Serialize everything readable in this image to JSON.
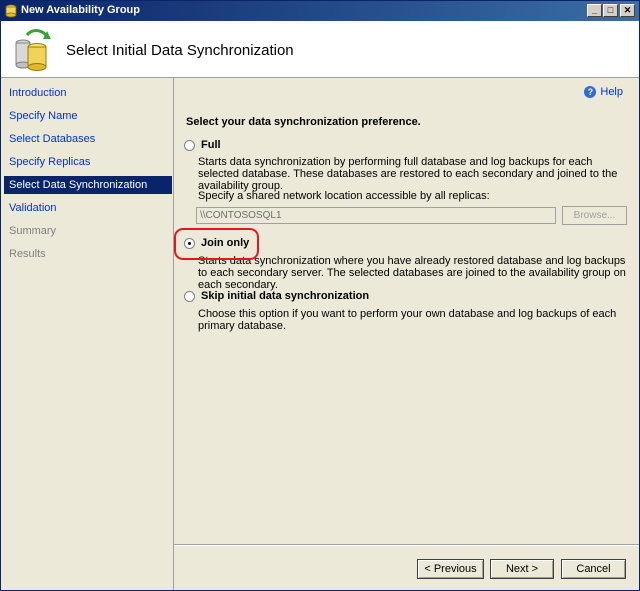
{
  "window": {
    "title": "New Availability Group",
    "controls": {
      "minimize": "_",
      "maximize": "□",
      "close": "✕"
    }
  },
  "header": {
    "title": "Select Initial Data Synchronization"
  },
  "sidebar": {
    "items": [
      {
        "label": "Introduction",
        "state": "link"
      },
      {
        "label": "Specify Name",
        "state": "link"
      },
      {
        "label": "Select Databases",
        "state": "link"
      },
      {
        "label": "Specify Replicas",
        "state": "link"
      },
      {
        "label": "Select Data Synchronization",
        "state": "selected"
      },
      {
        "label": "Validation",
        "state": "link"
      },
      {
        "label": "Summary",
        "state": "disabled"
      },
      {
        "label": "Results",
        "state": "disabled"
      }
    ]
  },
  "main": {
    "help_label": "Help",
    "prompt": "Select your data synchronization preference.",
    "options": [
      {
        "label": "Full",
        "selected": false,
        "description": "Starts data synchronization by performing full database and log backups for each selected database. These databases are restored to each secondary and joined to the availability group."
      },
      {
        "label": "Join only",
        "selected": true,
        "description": "Starts data synchronization where you have already restored database and log backups to each secondary server. The selected databases are joined to the availability group on each secondary."
      },
      {
        "label": "Skip initial data synchronization",
        "selected": false,
        "description": "Choose this option if you want to perform your own database and log backups of each primary database."
      }
    ],
    "share_label": "Specify a shared network location accessible by all replicas:",
    "share_value": "\\\\CONTOSOSQL1",
    "browse_label": "Browse..."
  },
  "footer": {
    "previous_label": "< Previous",
    "next_label": "Next >",
    "cancel_label": "Cancel"
  },
  "colors": {
    "selection": "#0a246a",
    "link": "#0033cc",
    "highlight": "#e8151b"
  }
}
